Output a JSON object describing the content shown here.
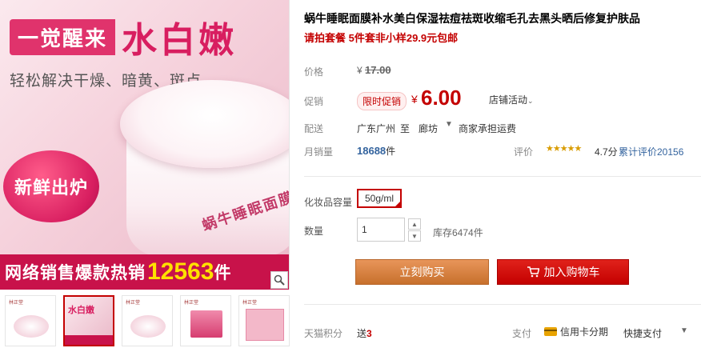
{
  "gallery": {
    "hero_line1_a": "一觉醒来",
    "hero_line1_b": "水白嫩",
    "hero_line2": "轻松解决干燥、暗黄、斑点",
    "jar_label": "蜗牛睡眠面膜",
    "fresh_badge": "新鲜出炉",
    "sale_text": "网络销售爆款热销",
    "sale_number": "12563",
    "sale_unit": "件",
    "thumb_brand": "林正堂",
    "thumb_hero": "水白嫩"
  },
  "product": {
    "title": "蜗牛睡眠面膜补水美白保湿祛痘祛斑收缩毛孔去黑头晒后修复护肤品",
    "subtitle": "请拍套餐 5件套非小样29.9元包邮"
  },
  "price": {
    "orig_label": "价格",
    "currency": "¥",
    "orig_price": "17.00",
    "promo_label": "促销",
    "promo_tag": "限时促销",
    "promo_price": "6.00",
    "shop_promo": "店铺活动",
    "ship_label": "配送",
    "ship_from": "广东广州",
    "ship_to_word": "至",
    "ship_city": "廊坊",
    "ship_fee": "商家承担运费",
    "sales_label": "月销量",
    "sales_count": "18688",
    "sales_unit": "件",
    "review_label": "评价",
    "rating": "4.7分",
    "review_link": "累计评价20156"
  },
  "options": {
    "size_label": "化妆品容量",
    "size_value": "50g/ml",
    "qty_label": "数量",
    "qty_value": "1",
    "stock": "库存6474件"
  },
  "actions": {
    "buy_now": "立刻购买",
    "add_cart": "加入购物车"
  },
  "footer": {
    "points_label": "天猫积分",
    "points_prefix": "送",
    "points_value": "3",
    "pay_label": "支付",
    "pay_credit": "信用卡分期",
    "pay_quick": "快捷支付"
  },
  "colors": {
    "accent_red": "#c40000",
    "buy_orange": "#c7702c",
    "link_blue": "#33639e"
  }
}
